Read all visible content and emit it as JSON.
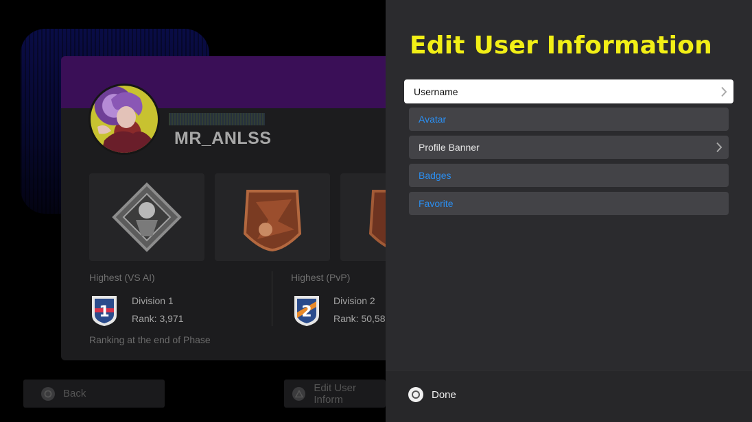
{
  "background": {
    "player_name": "MR_ANLSS",
    "ranks": [
      {
        "label": "Highest (VS AI)",
        "emblem_number": "1",
        "division": "Division 1",
        "rank": "Rank: 3,971"
      },
      {
        "label": "Highest (PvP)",
        "emblem_number": "2",
        "division": "Division 2",
        "rank": "Rank: 50,58"
      }
    ],
    "footnote": "Ranking at the end of Phase",
    "footer": {
      "back_label": "Back",
      "edit_label": "Edit User Inform"
    }
  },
  "panel": {
    "title": "Edit User Information",
    "items": [
      {
        "label": "Username",
        "state": "selected",
        "has_chevron": true
      },
      {
        "label": "Avatar",
        "state": "link",
        "has_chevron": false
      },
      {
        "label": "Profile Banner",
        "state": "normal",
        "has_chevron": true
      },
      {
        "label": "Badges",
        "state": "link",
        "has_chevron": false
      },
      {
        "label": "Favorite",
        "state": "link",
        "has_chevron": false
      }
    ],
    "done_label": "Done"
  },
  "colors": {
    "title_yellow": "#f2ef16",
    "link_blue": "#2b8ef0",
    "banner_purple": "#3a0f57",
    "panel_bg": "#2b2b2e"
  },
  "icons": {
    "done": "circle-button-icon",
    "back": "circle-button-icon",
    "edit": "triangle-button-icon",
    "chevron": "chevron-right-icon"
  }
}
